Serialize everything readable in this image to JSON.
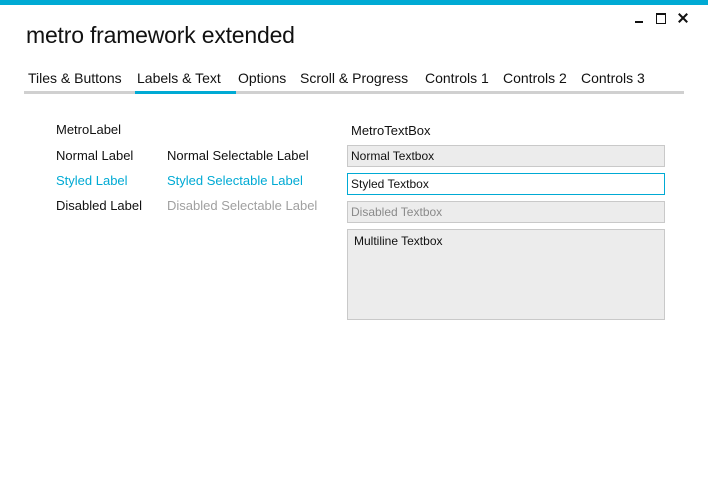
{
  "window": {
    "title": "metro framework extended",
    "controls": {
      "minimize_icon": "minimize-icon",
      "maximize_icon": "maximize-icon",
      "close_icon": "close-icon"
    },
    "accent_color": "#00aad4"
  },
  "tabs": [
    {
      "label": "Tiles & Buttons",
      "active": false
    },
    {
      "label": "Labels & Text",
      "active": true
    },
    {
      "label": "Options",
      "active": false
    },
    {
      "label": "Scroll & Progress",
      "active": false
    },
    {
      "label": "Controls 1",
      "active": false
    },
    {
      "label": "Controls 2",
      "active": false
    },
    {
      "label": "Controls 3",
      "active": false
    }
  ],
  "labels_section": {
    "heading": "MetroLabel",
    "normal_label": "Normal Label",
    "normal_selectable_label": "Normal Selectable Label",
    "styled_label": "Styled Label",
    "styled_selectable_label": "Styled Selectable Label",
    "disabled_label": "Disabled Label",
    "disabled_selectable_label": "Disabled Selectable Label"
  },
  "textbox_section": {
    "heading": "MetroTextBox",
    "normal_textbox": "Normal Textbox",
    "styled_textbox": "Styled Textbox",
    "disabled_textbox": "Disabled Textbox",
    "multiline_textbox": "Multiline Textbox"
  },
  "colors": {
    "accent": "#00aad4",
    "disabled_text": "#a0a0a0",
    "textbox_bg": "#ececec"
  }
}
